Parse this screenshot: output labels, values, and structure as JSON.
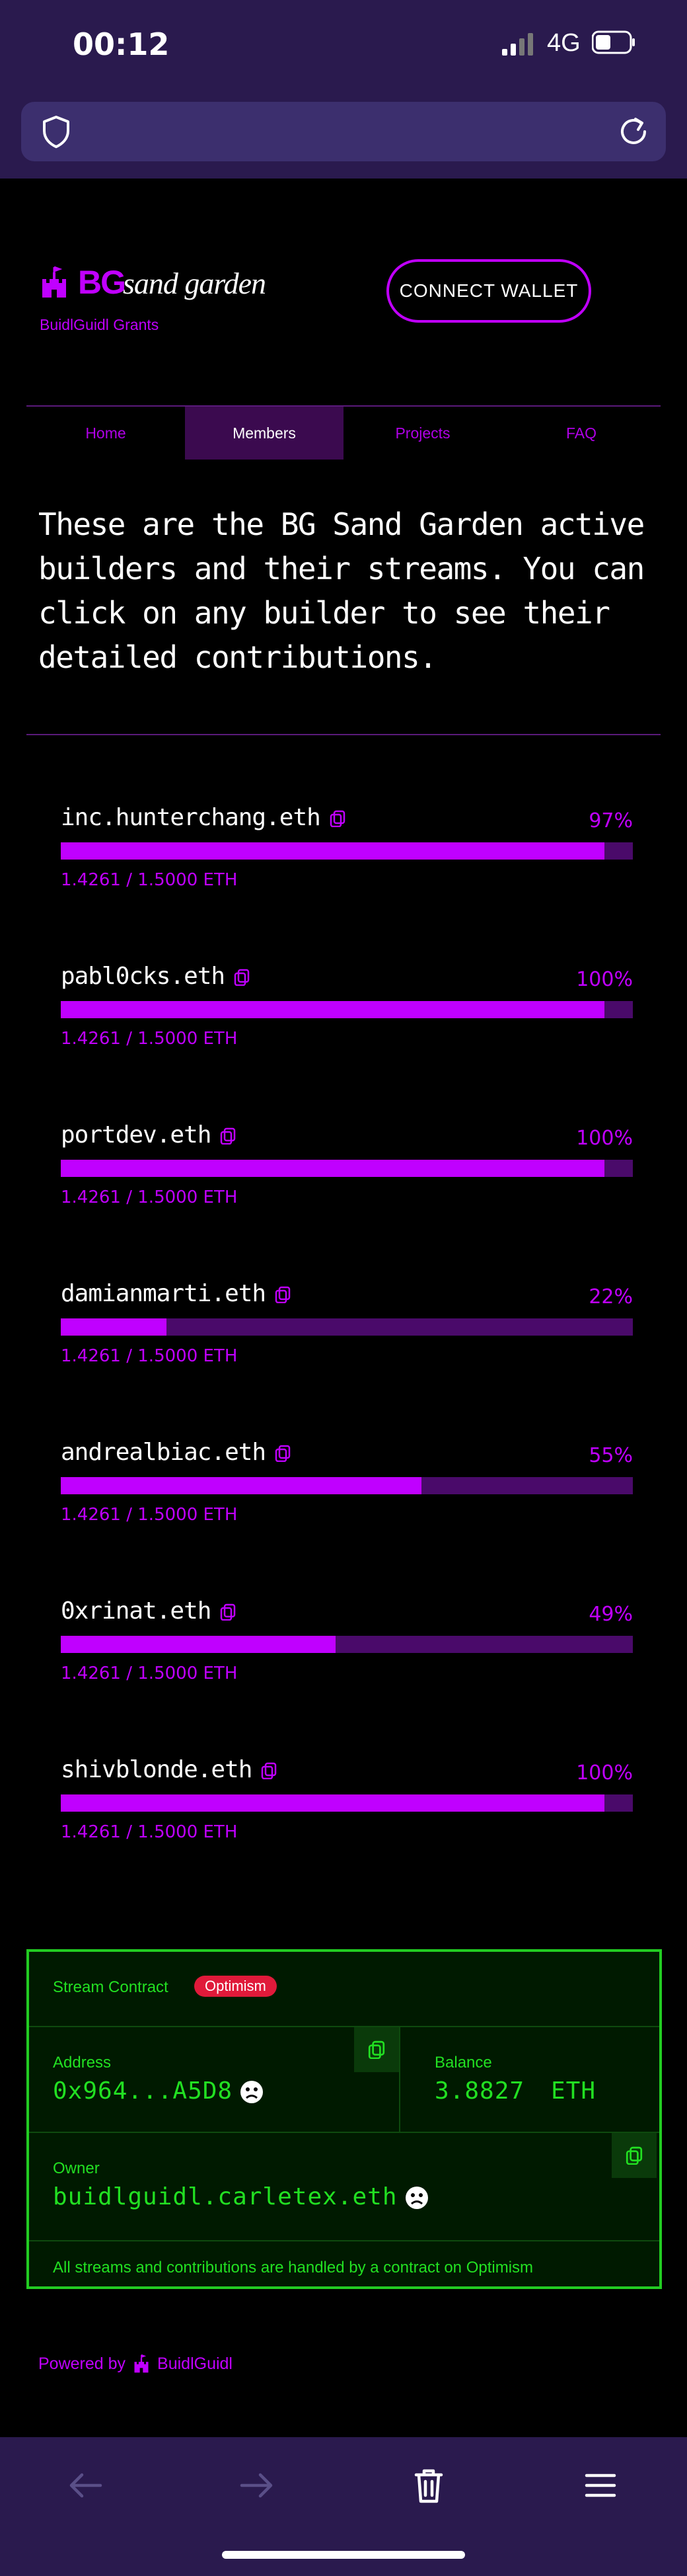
{
  "status_bar": {
    "time": "00:12",
    "network": "4G"
  },
  "header": {
    "logo_bg": "BG",
    "logo_sand_garden": "sand garden",
    "subtitle": "BuidlGuidl Grants",
    "connect_wallet": "CONNECT WALLET"
  },
  "nav": {
    "tabs": [
      {
        "label": "Home"
      },
      {
        "label": "Members"
      },
      {
        "label": "Projects"
      },
      {
        "label": "FAQ"
      }
    ]
  },
  "intro": "These are the BG Sand Garden active builders and their streams. You can click on any builder to see their detailed contributions.",
  "builders": [
    {
      "name": "inc.hunterchang.eth",
      "percent": "97%",
      "eth": "1.4261 / 1.5000 ETH",
      "fill": 0.95
    },
    {
      "name": "pabl0cks.eth",
      "percent": "100%",
      "eth": "1.4261 / 1.5000 ETH",
      "fill": 0.95
    },
    {
      "name": "portdev.eth",
      "percent": "100%",
      "eth": "1.4261 / 1.5000 ETH",
      "fill": 0.95
    },
    {
      "name": "damianmarti.eth",
      "percent": "22%",
      "eth": "1.4261 / 1.5000 ETH",
      "fill": 0.185
    },
    {
      "name": "andrealbiac.eth",
      "percent": "55%",
      "eth": "1.4261 / 1.5000 ETH",
      "fill": 0.63
    },
    {
      "name": "0xrinat.eth",
      "percent": "49%",
      "eth": "1.4261 / 1.5000 ETH",
      "fill": 0.48
    },
    {
      "name": "shivblonde.eth",
      "percent": "100%",
      "eth": "1.4261 / 1.5000 ETH",
      "fill": 0.95
    }
  ],
  "contract": {
    "title": "Stream Contract",
    "network_badge": "Optimism",
    "address_label": "Address",
    "address_value": "0x964...A5D8",
    "balance_label": "Balance",
    "balance_value": "3.8827",
    "balance_unit": "ETH",
    "owner_label": "Owner",
    "owner_value": "buidlguidl.carletex.eth",
    "footer": "All streams and contributions are handled by a contract on Optimism"
  },
  "powered_by": {
    "label": "Powered by",
    "brand": "BuidlGuidl"
  },
  "colors": {
    "accent": "#c000ff",
    "contract_green": "#22e022",
    "badge_red": "#e01a3a",
    "chrome": "#2a1a4e"
  }
}
